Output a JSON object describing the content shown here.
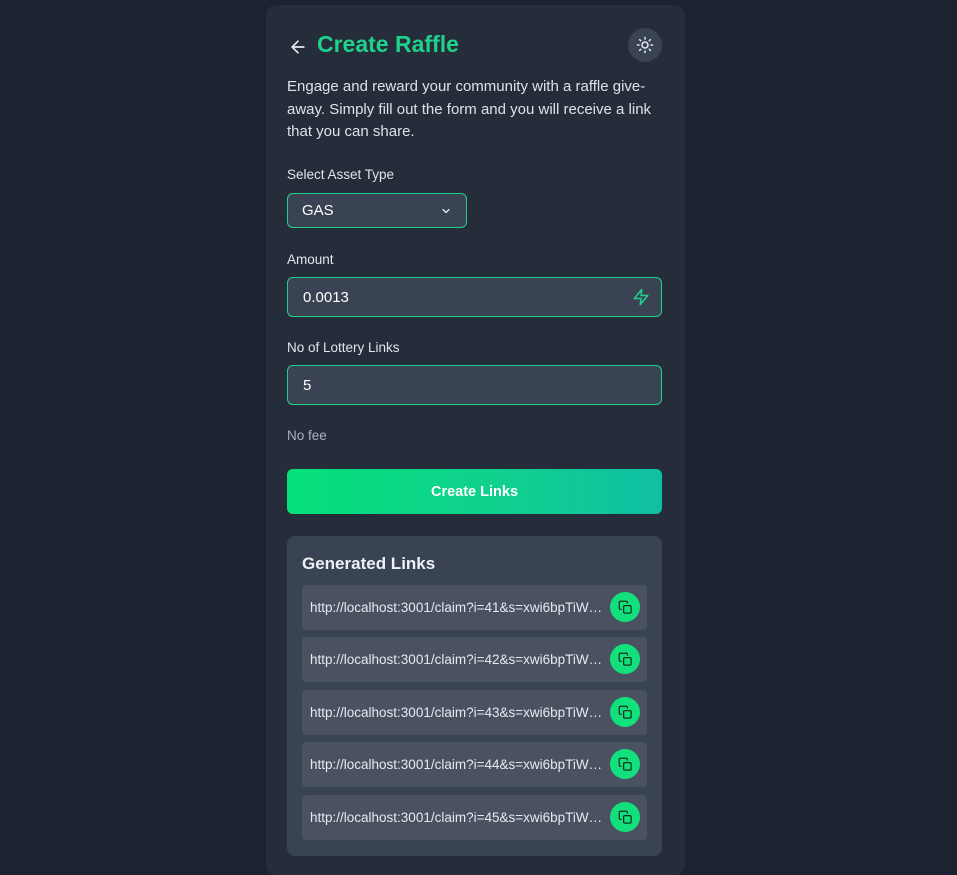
{
  "page": {
    "title": "Create Raffle",
    "intro": "Engage and reward your community with a raffle give-away. Simply fill out the form and you will receive a link that you can share."
  },
  "form": {
    "asset_label": "Select Asset Type",
    "asset_value": "GAS",
    "amount_label": "Amount",
    "amount_value": "0.0013",
    "links_label": "No of Lottery Links",
    "links_value": "5",
    "fee_text": "No fee",
    "submit_label": "Create Links"
  },
  "generated": {
    "title": "Generated Links",
    "links": [
      "http://localhost:3001/claim?i=41&s=xwi6bpTiWz…",
      "http://localhost:3001/claim?i=42&s=xwi6bpTiWz…",
      "http://localhost:3001/claim?i=43&s=xwi6bpTiWz…",
      "http://localhost:3001/claim?i=44&s=xwi6bpTiWz…",
      "http://localhost:3001/claim?i=45&s=xwi6bpTiWz…"
    ]
  },
  "icons": {
    "back": "arrow-left-icon",
    "theme": "sun-icon",
    "select": "chevron-down-icon",
    "amount": "lightning-icon",
    "copy": "copy-icon"
  },
  "colors": {
    "accent": "#1fd18a",
    "background": "#1b2230",
    "card": "#252d3b",
    "field": "#3a4354"
  }
}
